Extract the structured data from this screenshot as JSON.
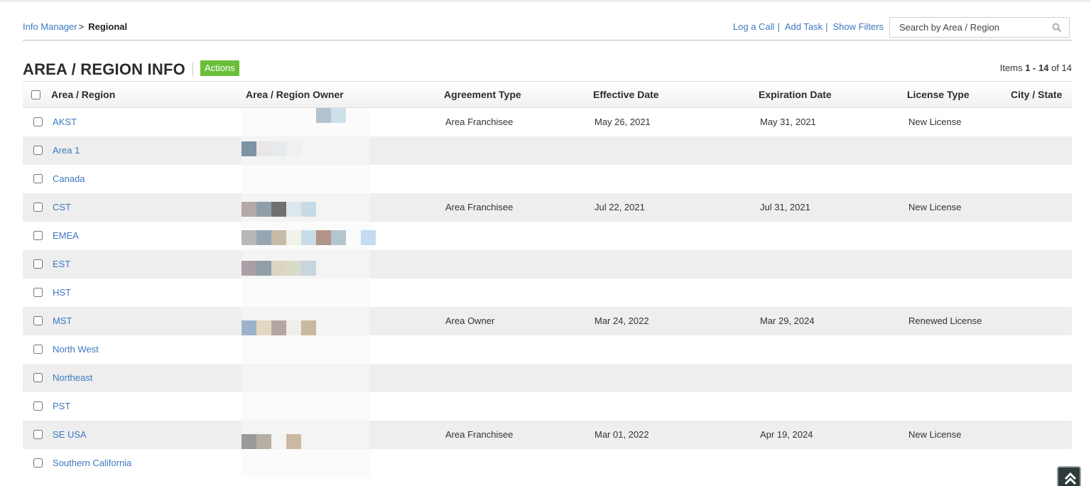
{
  "breadcrumb": {
    "parent": "Info Manager",
    "separator": ">",
    "current": "Regional"
  },
  "toolbar": {
    "log_call": "Log a Call",
    "add_task": "Add Task",
    "show_filters": "Show Filters",
    "separator": "|",
    "search_placeholder": "Search by Area / Region",
    "search_icon": "search-icon"
  },
  "page": {
    "title": "AREA / REGION INFO",
    "actions_label": "Actions",
    "items_prefix": "Items",
    "items_range": "1 - 14",
    "items_of": "of 14"
  },
  "columns": {
    "area": "Area / Region",
    "owner": "Area / Region Owner",
    "agreement": "Agreement Type",
    "effective": "Effective Date",
    "expiration": "Expiration Date",
    "license": "License Type",
    "city": "City / State"
  },
  "rows": [
    {
      "area": "AKST",
      "agreement": "Area Franchisee",
      "effective": "May 26, 2021",
      "expiration": "May 31, 2021",
      "license": "New License",
      "city": ""
    },
    {
      "area": "Area 1",
      "agreement": "",
      "effective": "",
      "expiration": "",
      "license": "",
      "city": ""
    },
    {
      "area": "Canada",
      "agreement": "",
      "effective": "",
      "expiration": "",
      "license": "",
      "city": ""
    },
    {
      "area": "CST",
      "agreement": "Area Franchisee",
      "effective": "Jul 22, 2021",
      "expiration": "Jul 31, 2021",
      "license": "New License",
      "city": ""
    },
    {
      "area": "EMEA",
      "agreement": "",
      "effective": "",
      "expiration": "",
      "license": "",
      "city": ""
    },
    {
      "area": "EST",
      "agreement": "",
      "effective": "",
      "expiration": "",
      "license": "",
      "city": ""
    },
    {
      "area": "HST",
      "agreement": "",
      "effective": "",
      "expiration": "",
      "license": "",
      "city": ""
    },
    {
      "area": "MST",
      "agreement": "Area Owner",
      "effective": "Mar 24, 2022",
      "expiration": "Mar 29, 2024",
      "license": "Renewed License",
      "city": ""
    },
    {
      "area": "North West",
      "agreement": "",
      "effective": "",
      "expiration": "",
      "license": "",
      "city": ""
    },
    {
      "area": "Northeast",
      "agreement": "",
      "effective": "",
      "expiration": "",
      "license": "",
      "city": ""
    },
    {
      "area": "PST",
      "agreement": "",
      "effective": "",
      "expiration": "",
      "license": "",
      "city": ""
    },
    {
      "area": "SE USA",
      "agreement": "Area Franchisee",
      "effective": "Mar 01, 2022",
      "expiration": "Apr 19, 2024",
      "license": "New License",
      "city": ""
    },
    {
      "area": "Southern California",
      "agreement": "",
      "effective": "",
      "expiration": "",
      "license": "",
      "city": ""
    }
  ],
  "colors": {
    "link": "#3f78c0",
    "actions_green": "#6abf3a",
    "row_alt": "#edeeed"
  }
}
